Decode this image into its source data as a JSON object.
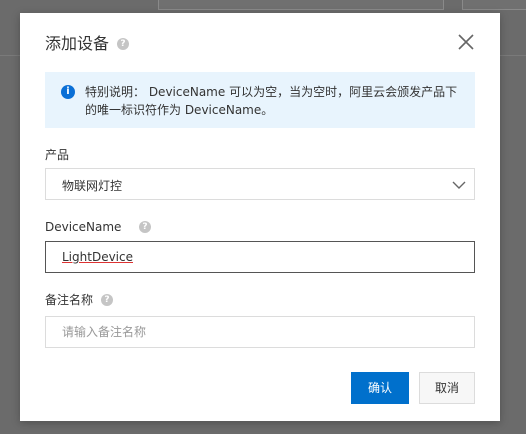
{
  "dialog": {
    "title": "添加设备",
    "notice": "特别说明： DeviceName 可以为空，当为空时，阿里云会颁发产品下的唯一标识符作为 DeviceName。",
    "product": {
      "label": "产品",
      "value": "物联网灯控"
    },
    "device_name": {
      "label": "DeviceName",
      "value": "LightDevice"
    },
    "remark": {
      "label": "备注名称",
      "placeholder": "请输入备注名称"
    },
    "buttons": {
      "ok": "确认",
      "cancel": "取消"
    }
  },
  "colors": {
    "primary": "#0070cc",
    "notice_bg": "#e8f4fd",
    "info_icon": "#0a6fd6"
  }
}
